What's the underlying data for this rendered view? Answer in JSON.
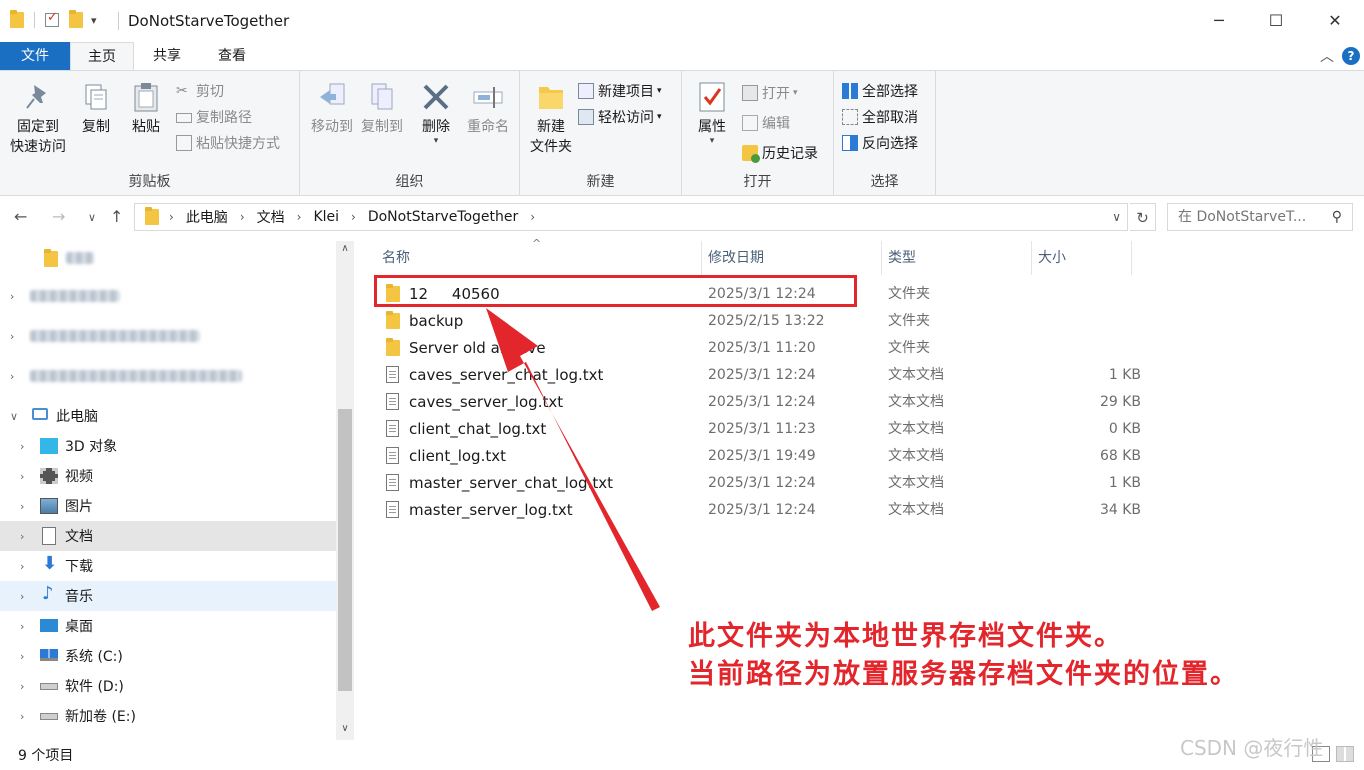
{
  "window": {
    "title": "DoNotStarveTogether",
    "minimize": "─",
    "maximize": "☐",
    "close": "✕"
  },
  "ribbon_tabs": [
    {
      "label": "文件"
    },
    {
      "label": "主页"
    },
    {
      "label": "共享"
    },
    {
      "label": "查看"
    }
  ],
  "ribbon": {
    "clipboard": {
      "label": "剪贴板",
      "pin_line1": "固定到",
      "pin_line2": "快速访问",
      "copy": "复制",
      "paste": "粘贴",
      "cut": "剪切",
      "copy_path": "复制路径",
      "paste_shortcut": "粘贴快捷方式"
    },
    "organize": {
      "label": "组织",
      "move_to": "移动到",
      "copy_to": "复制到",
      "delete": "删除",
      "rename": "重命名"
    },
    "new": {
      "label": "新建",
      "new_folder_line1": "新建",
      "new_folder_line2": "文件夹",
      "new_item": "新建项目",
      "easy_access": "轻松访问"
    },
    "open": {
      "label": "打开",
      "properties": "属性",
      "open": "打开",
      "edit": "编辑",
      "history": "历史记录"
    },
    "select": {
      "label": "选择",
      "select_all": "全部选择",
      "select_none": "全部取消",
      "invert": "反向选择"
    }
  },
  "address": {
    "crumbs": [
      "此电脑",
      "文档",
      "Klei",
      "DoNotStarveTogether"
    ],
    "search_placeholder": "在 DoNotStarveT..."
  },
  "nav": {
    "items": [
      {
        "label": "此电脑"
      },
      {
        "label": "3D 对象"
      },
      {
        "label": "视频"
      },
      {
        "label": "图片"
      },
      {
        "label": "文档"
      },
      {
        "label": "下载"
      },
      {
        "label": "音乐"
      },
      {
        "label": "桌面"
      },
      {
        "label": "系统 (C:)"
      },
      {
        "label": "软件 (D:)"
      },
      {
        "label": "新加卷 (E:)"
      }
    ]
  },
  "columns": {
    "name": "名称",
    "date": "修改日期",
    "type": "类型",
    "size": "大小"
  },
  "files": [
    {
      "name": "12     40560",
      "date": "2025/3/1 12:24",
      "type": "文件夹",
      "size": "",
      "kind": "folder"
    },
    {
      "name": "backup",
      "date": "2025/2/15 13:22",
      "type": "文件夹",
      "size": "",
      "kind": "folder"
    },
    {
      "name": "Server old archive",
      "date": "2025/3/1 11:20",
      "type": "文件夹",
      "size": "",
      "kind": "folder"
    },
    {
      "name": "caves_server_chat_log.txt",
      "date": "2025/3/1 12:24",
      "type": "文本文档",
      "size": "1 KB",
      "kind": "doc"
    },
    {
      "name": "caves_server_log.txt",
      "date": "2025/3/1 12:24",
      "type": "文本文档",
      "size": "29 KB",
      "kind": "doc"
    },
    {
      "name": "client_chat_log.txt",
      "date": "2025/3/1 11:23",
      "type": "文本文档",
      "size": "0 KB",
      "kind": "doc"
    },
    {
      "name": "client_log.txt",
      "date": "2025/3/1 19:49",
      "type": "文本文档",
      "size": "68 KB",
      "kind": "doc"
    },
    {
      "name": "master_server_chat_log.txt",
      "date": "2025/3/1 12:24",
      "type": "文本文档",
      "size": "1 KB",
      "kind": "doc"
    },
    {
      "name": "master_server_log.txt",
      "date": "2025/3/1 12:24",
      "type": "文本文档",
      "size": "34 KB",
      "kind": "doc"
    }
  ],
  "status": {
    "count": "9 个项目"
  },
  "annotation": {
    "line1": "此文件夹为本地世界存档文件夹。",
    "line2": "当前路径为放置服务器存档文件夹的位置。",
    "color": "#e3262c"
  },
  "watermark": "CSDN @夜行性"
}
